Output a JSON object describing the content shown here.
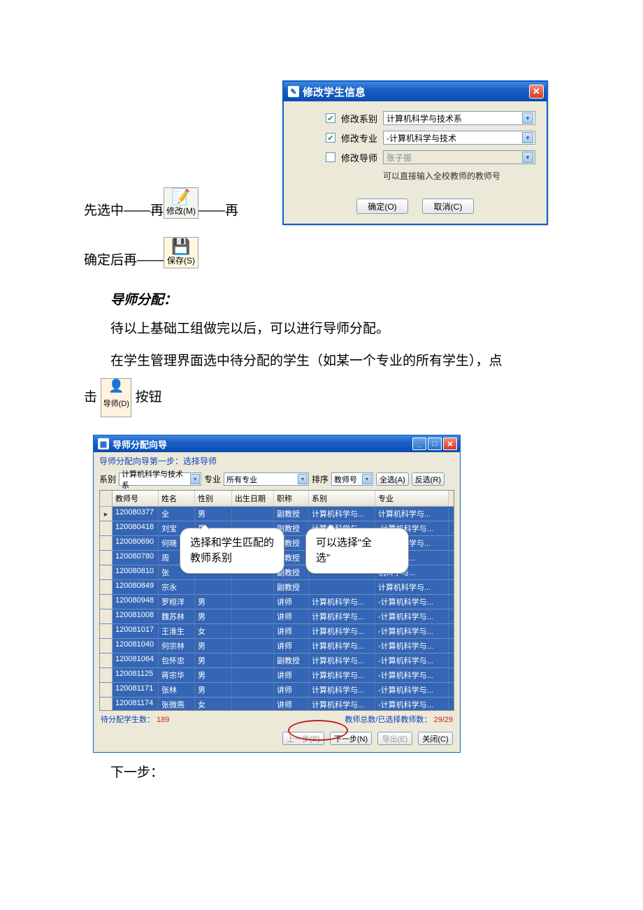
{
  "dialog1": {
    "title": "修改学生信息",
    "row1_label": "修改系别",
    "row1_value": "计算机科学与技术系",
    "row2_label": "修改专业",
    "row2_value": "-计算机科学与技术",
    "row3_label": "修改导师",
    "row3_value": "张子振",
    "hint": "可以直接输入全校教师的教师号",
    "ok": "确定(O)",
    "cancel": "取消(C)"
  },
  "buttons": {
    "modify": "修改(M)",
    "save": "保存(S)",
    "tutor": "导师(D)"
  },
  "text": {
    "line1_a": "先选中——再",
    "line1_b": "——再",
    "line2_a": "确定后再——",
    "heading": "导师分配：",
    "p1": "待以上基础工组做完以后，可以进行导师分配。",
    "p2a": "在学生管理界面选中待分配的学生（如某一个专业的所有学生），点",
    "p2b_pre": "击",
    "p2b_post": "按钮",
    "p3": "下一步："
  },
  "dialog2": {
    "title": "导师分配向导",
    "subtitle": "导师分配向导第一步：选择导师",
    "lbl_dept": "系别",
    "sel_dept": "计算机科学与技术系",
    "lbl_major": "专业",
    "sel_major": "所有专业",
    "lbl_sort": "排序",
    "sel_sort": "教师号",
    "btn_all": "全选(A)",
    "btn_inv": "反选(R)",
    "headers": [
      "教师号",
      "姓名",
      "性别",
      "出生日期",
      "职称",
      "系别",
      "专业"
    ],
    "rows": [
      {
        "id": "120080377",
        "name": "全",
        "sex": "男",
        "bd": "",
        "title": "副教授",
        "dept": "计算机科学与...",
        "major": "计算机科学与..."
      },
      {
        "id": "120080418",
        "name": "刘宝",
        "sex": "男",
        "bd": "",
        "title": "副教授",
        "dept": "计算机科学与...",
        "major": "-计算机科学与..."
      },
      {
        "id": "120080690",
        "name": "何晓",
        "sex": "",
        "bd": "",
        "title": "副教授",
        "dept": "",
        "major": "计算机科学与..."
      },
      {
        "id": "120080780",
        "name": "周",
        "sex": "",
        "bd": "",
        "title": "副教授",
        "dept": "",
        "major": "机科学与..."
      },
      {
        "id": "120080810",
        "name": "张",
        "sex": "",
        "bd": "",
        "title": "副教授",
        "dept": "",
        "major": "机科学与..."
      },
      {
        "id": "120080849",
        "name": "宗永",
        "sex": "",
        "bd": "",
        "title": "副教授",
        "dept": "",
        "major": "计算机科学与..."
      },
      {
        "id": "120080948",
        "name": "罗桓洋",
        "sex": "男",
        "bd": "",
        "title": "讲师",
        "dept": "计算机科学与...",
        "major": "-计算机科学与..."
      },
      {
        "id": "120081008",
        "name": "魏苏林",
        "sex": "男",
        "bd": "",
        "title": "讲师",
        "dept": "计算机科学与...",
        "major": "-计算机科学与..."
      },
      {
        "id": "120081017",
        "name": "王淮生",
        "sex": "女",
        "bd": "",
        "title": "讲师",
        "dept": "计算机科学与...",
        "major": "-计算机科学与..."
      },
      {
        "id": "120081040",
        "name": "何宗林",
        "sex": "男",
        "bd": "",
        "title": "讲师",
        "dept": "计算机科学与...",
        "major": "-计算机科学与..."
      },
      {
        "id": "120081064",
        "name": "包怀忠",
        "sex": "男",
        "bd": "",
        "title": "副教授",
        "dept": "计算机科学与...",
        "major": "-计算机科学与..."
      },
      {
        "id": "120081125",
        "name": "蒋宗华",
        "sex": "男",
        "bd": "",
        "title": "讲师",
        "dept": "计算机科学与...",
        "major": "-计算机科学与..."
      },
      {
        "id": "120081171",
        "name": "张林",
        "sex": "男",
        "bd": "",
        "title": "讲师",
        "dept": "计算机科学与...",
        "major": "-计算机科学与..."
      },
      {
        "id": "120081174",
        "name": "张微燕",
        "sex": "女",
        "bd": "",
        "title": "讲师",
        "dept": "计算机科学与...",
        "major": "-计算机科学与..."
      }
    ],
    "status_left_label": "待分配学生数：",
    "status_left_value": "189",
    "status_right_label": "教师总数/已选择教师数：",
    "status_right_value": "29/29",
    "prev": "上一步(P)",
    "next": "下一步(N)",
    "export": "导出(E)",
    "close": "关闭(C)"
  },
  "callouts": {
    "c1": "选择和学生匹配的教师系别",
    "c2a": "可以选择“全",
    "c2b": "选”"
  }
}
